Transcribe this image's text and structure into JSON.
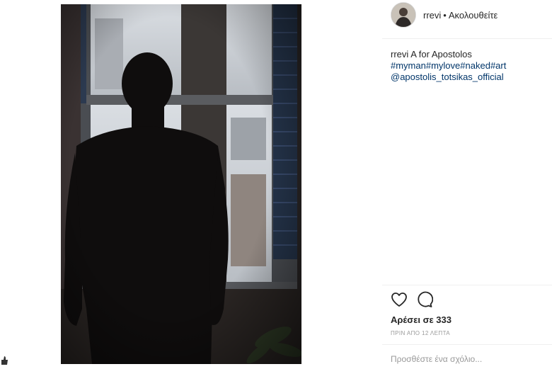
{
  "post": {
    "username": "rrevi",
    "separator": "•",
    "follow_status": "Ακολουθείτε",
    "caption": {
      "user": "rrevi",
      "text": "A for Apostolos",
      "hashtags": [
        "#myman",
        "#mylove",
        "#naked",
        "#art"
      ],
      "mention": "@apostolis_totsikas_official"
    },
    "likes": "Αρέσει σε 333",
    "timestamp": "ΠΡΙΝ ΑΠΟ 12 ΛΕΠΤΑ",
    "comment_placeholder": "Προσθέστε ένα σχόλιο..."
  },
  "colors": {
    "link": "#003569",
    "text": "#262626",
    "muted": "#999999",
    "border": "#efefef"
  },
  "icons": {
    "like": "heart-icon",
    "comment": "comment-bubble-icon"
  }
}
